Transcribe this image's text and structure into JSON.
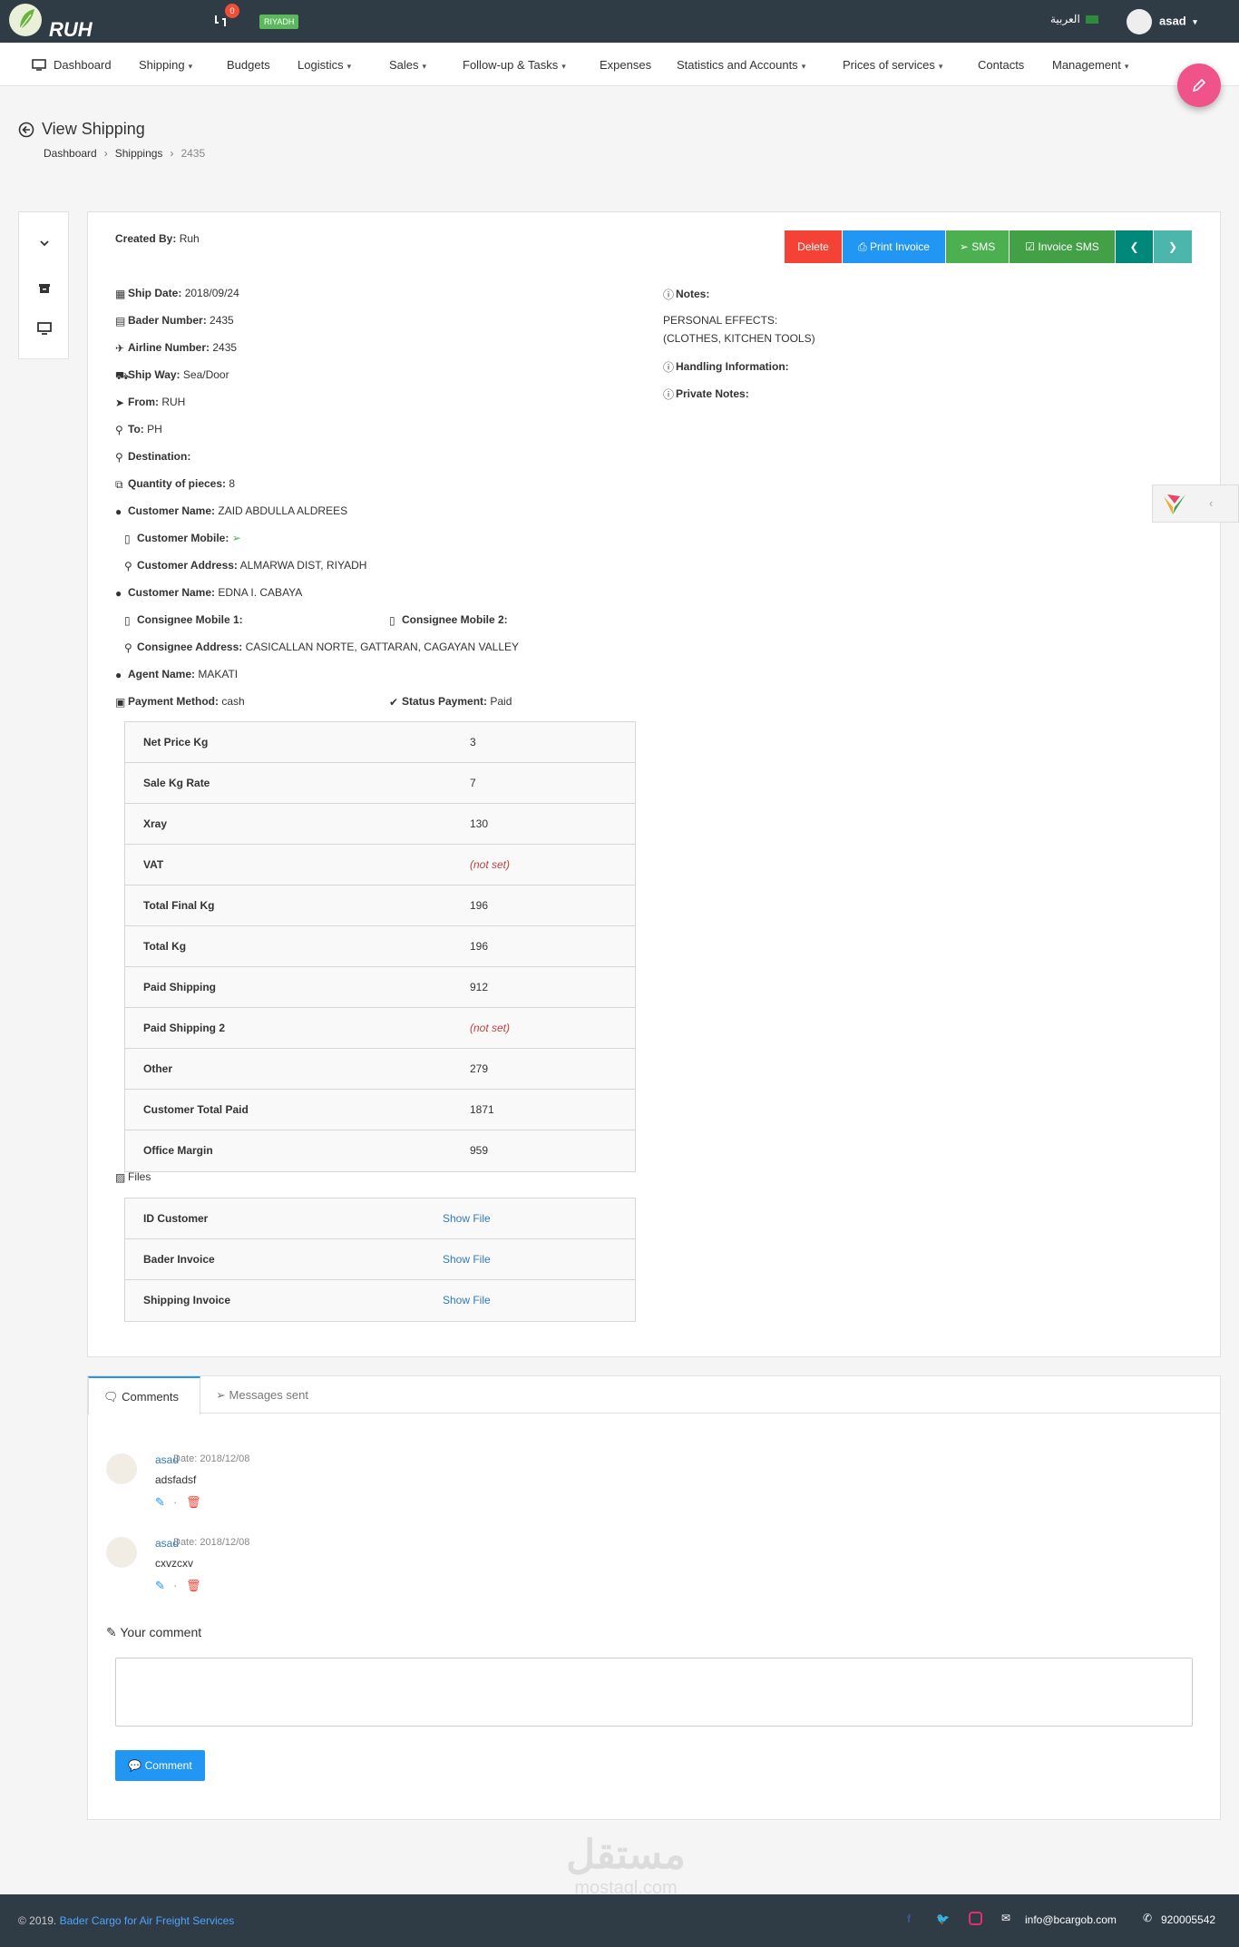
{
  "header": {
    "logo_text": "RUH",
    "notification_count": "0",
    "branch": "RIYADH",
    "language": "العربية",
    "username": "asad"
  },
  "nav": {
    "items": [
      {
        "label": "Dashboard",
        "dropdown": false
      },
      {
        "label": "Shipping",
        "dropdown": true
      },
      {
        "label": "Budgets",
        "dropdown": false
      },
      {
        "label": "Logistics",
        "dropdown": true
      },
      {
        "label": "Sales",
        "dropdown": true
      },
      {
        "label": "Follow-up & Tasks",
        "dropdown": true
      },
      {
        "label": "Expenses",
        "dropdown": false
      },
      {
        "label": "Statistics and Accounts",
        "dropdown": true
      },
      {
        "label": "Prices of services",
        "dropdown": true
      },
      {
        "label": "Contacts",
        "dropdown": false
      },
      {
        "label": "Management",
        "dropdown": true
      }
    ]
  },
  "page": {
    "title": "View Shipping",
    "breadcrumb": [
      "Dashboard",
      "Shippings",
      "2435"
    ]
  },
  "detail": {
    "created_by_label": "Created By:",
    "created_by": "Ruh",
    "buttons": {
      "delete": "Delete",
      "print_invoice": "Print Invoice",
      "sms": "SMS",
      "invoice_sms": "Invoice SMS"
    },
    "fields": {
      "ship_date": {
        "label": "Ship Date:",
        "value": "2018/09/24"
      },
      "bader_number": {
        "label": "Bader Number:",
        "value": "2435"
      },
      "airline_number": {
        "label": "Airline Number:",
        "value": "2435"
      },
      "ship_way": {
        "label": "Ship Way:",
        "value": "Sea/Door"
      },
      "from": {
        "label": "From:",
        "value": "RUH"
      },
      "to": {
        "label": "To:",
        "value": "PH"
      },
      "destination": {
        "label": "Destination:",
        "value": ""
      },
      "quantity": {
        "label": "Quantity of pieces:",
        "value": "8"
      },
      "customer_name": {
        "label": "Customer Name:",
        "value": "ZAID ABDULLA ALDREES"
      },
      "customer_mobile": {
        "label": "Customer Mobile:",
        "value": ""
      },
      "customer_address": {
        "label": "Customer Address:",
        "value": "ALMARWA DIST, RIYADH"
      },
      "consignee_name": {
        "label": "Customer Name:",
        "value": "EDNA I. CABAYA"
      },
      "consignee_mobile_1": {
        "label": "Consignee Mobile 1:",
        "value": ""
      },
      "consignee_mobile_2": {
        "label": "Consignee Mobile 2:",
        "value": ""
      },
      "consignee_address": {
        "label": "Consignee Address:",
        "value": "CASICALLAN NORTE, GATTARAN, CAGAYAN VALLEY"
      },
      "agent_name": {
        "label": "Agent Name:",
        "value": "MAKATI"
      },
      "payment_method": {
        "label": "Payment Method:",
        "value": "cash"
      },
      "status_payment": {
        "label": "Status Payment:",
        "value": "Paid"
      }
    },
    "notes_label": "Notes:",
    "notes_line1": "PERSONAL EFFECTS:",
    "notes_line2": "(CLOTHES, KITCHEN TOOLS)",
    "handling_label": "Handling Information:",
    "private_notes_label": "Private Notes:",
    "price_table": [
      {
        "label": "Net Price Kg",
        "value": "3"
      },
      {
        "label": "Sale Kg Rate",
        "value": "7"
      },
      {
        "label": "Xray",
        "value": "130"
      },
      {
        "label": "VAT",
        "value": "(not set)"
      },
      {
        "label": "Total Final Kg",
        "value": "196"
      },
      {
        "label": "Total Kg",
        "value": "196"
      },
      {
        "label": "Paid Shipping",
        "value": "912"
      },
      {
        "label": "Paid Shipping 2",
        "value": "(not set)"
      },
      {
        "label": "Other",
        "value": "279"
      },
      {
        "label": "Customer Total Paid",
        "value": "1871"
      },
      {
        "label": "Office Margin",
        "value": "959"
      }
    ],
    "files_label": "Files",
    "files": [
      {
        "label": "ID Customer",
        "link": "Show File"
      },
      {
        "label": "Bader Invoice",
        "link": "Show File"
      },
      {
        "label": "Shipping Invoice",
        "link": "Show File"
      }
    ]
  },
  "comments": {
    "tabs": [
      "Comments",
      "Messages sent"
    ],
    "list": [
      {
        "author": "asad",
        "date": "Date: 2018/12/08",
        "text": "adsfadsf"
      },
      {
        "author": "asad",
        "date": "Date: 2018/12/08",
        "text": "cxvzcxv"
      }
    ],
    "your_comment_label": "Your comment",
    "submit_label": "Comment"
  },
  "footer": {
    "copyright": "© 2019.",
    "company": "Bader Cargo for Air Freight Services",
    "email": "info@bcargob.com",
    "phone": "920005542"
  },
  "watermark": {
    "arabic": "مستقل",
    "latin": "mostaql.com"
  },
  "colors": {
    "topbar": "#2f3b45",
    "delete": "#f44336",
    "print": "#2196f3",
    "sms": "#4caf50",
    "invoice_sms": "#43a047",
    "nav_prev": "#00897b",
    "nav_next": "#4db6ac",
    "fab": "#f0528a",
    "link": "#337ab7"
  }
}
